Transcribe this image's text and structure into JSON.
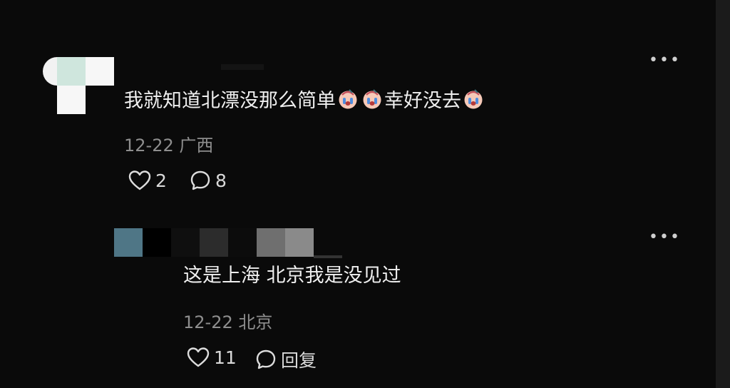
{
  "comment1": {
    "text_before": "我就知道北漂没那么简单",
    "text_after": "幸好没去",
    "date": "12-22",
    "location": "广西",
    "likes": "2",
    "replies": "8"
  },
  "comment2": {
    "text": "这是上海 北京我是没见过",
    "date": "12-22",
    "location": "北京",
    "likes": "11",
    "reply_label": "回复"
  },
  "icons": {
    "more": "more-dots-icon",
    "heart": "heart-icon",
    "reply": "speech-bubble-icon",
    "emoji": "crying-face-emoji"
  },
  "colors": {
    "background": "#0a0a0a",
    "text": "#efefef",
    "meta": "#8e8e8e"
  }
}
